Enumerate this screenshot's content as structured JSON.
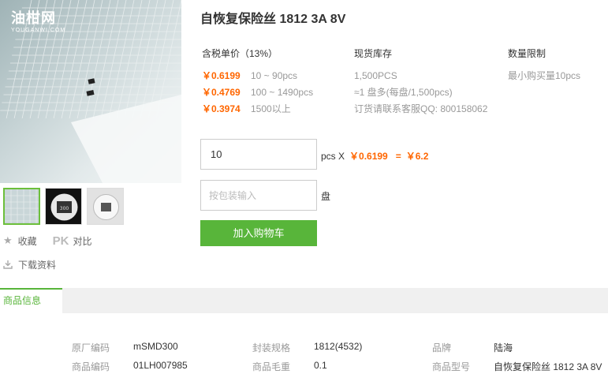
{
  "gallery": {
    "logo_text": "油柑网",
    "logo_sub": "YOUGANWI.COM",
    "chip_marking": "300"
  },
  "actions": {
    "favorite_label": "收藏",
    "pk_label": "PK",
    "compare_label": "对比",
    "download_label": "下载资料"
  },
  "product": {
    "title": "自恢复保险丝 1812 3A 8V"
  },
  "pricing": {
    "header": "含税单价（13%）",
    "tiers": [
      {
        "price": "￥0.6199",
        "range": "10 ~ 90pcs"
      },
      {
        "price": "￥0.4769",
        "range": "100 ~ 1490pcs"
      },
      {
        "price": "￥0.3974",
        "range": "1500以上"
      }
    ]
  },
  "stock": {
    "header": "现货库存",
    "qty": "1,500PCS",
    "per_reel": "≈1 盘多(每盘/1,500pcs)",
    "contact": "订货请联系客服QQ: 800158062"
  },
  "limit": {
    "header": "数量限制",
    "min": "最小购买量10pcs"
  },
  "order": {
    "qty_value": "10",
    "unit_x": "pcs X",
    "unit_price": "￥0.6199",
    "equals": "=",
    "total": "￥6.2",
    "pkg_placeholder": "按包装输入",
    "pkg_unit": "盘",
    "cart_label": "加入购物车"
  },
  "tabs": {
    "active": "商品信息"
  },
  "specs": [
    {
      "key": "原厂编码",
      "value": "mSMD300"
    },
    {
      "key": "封装规格",
      "value": "1812(4532)"
    },
    {
      "key": "品牌",
      "value": "陆海"
    },
    {
      "key": "商品编码",
      "value": "01LH007985"
    },
    {
      "key": "商品毛重",
      "value": "0.1"
    },
    {
      "key": "商品型号",
      "value": "自恢复保险丝 1812 3A 8V"
    }
  ]
}
